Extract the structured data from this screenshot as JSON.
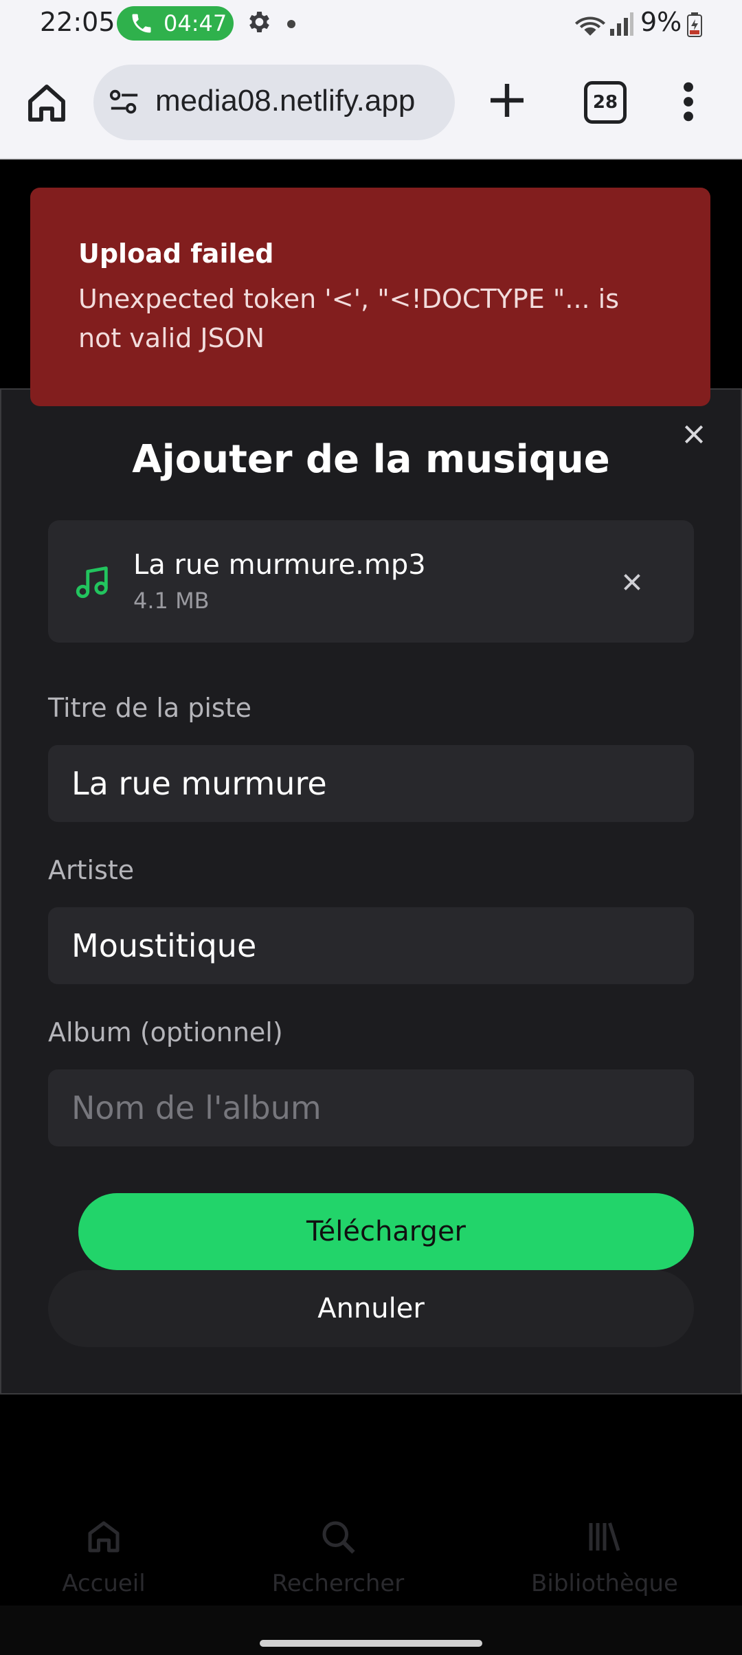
{
  "status_bar": {
    "time": "22:05",
    "call_timer": "04:47",
    "battery": "9%"
  },
  "browser": {
    "url": "media08.netlify.app",
    "tab_count": "28"
  },
  "toast": {
    "title": "Upload failed",
    "message": "Unexpected token '<', \"<!DOCTYPE \"... is not valid JSON",
    "color": "#821e1e"
  },
  "modal": {
    "title": "Ajouter de la musique",
    "file": {
      "name": "La rue murmure.mp3",
      "size": "4.1 MB"
    },
    "fields": {
      "track_title": {
        "label": "Titre de la piste",
        "value": "La rue murmure"
      },
      "artist": {
        "label": "Artiste",
        "value": "Moustitique"
      },
      "album": {
        "label": "Album (optionnel)",
        "value": "",
        "placeholder": "Nom de l'album"
      }
    },
    "buttons": {
      "upload": "Télécharger",
      "cancel": "Annuler"
    },
    "accent_color": "#22d46a"
  },
  "bottom_nav": {
    "items": [
      {
        "label": "Accueil",
        "icon": "home-icon"
      },
      {
        "label": "Rechercher",
        "icon": "search-icon"
      },
      {
        "label": "Bibliothèque",
        "icon": "library-icon"
      }
    ]
  }
}
